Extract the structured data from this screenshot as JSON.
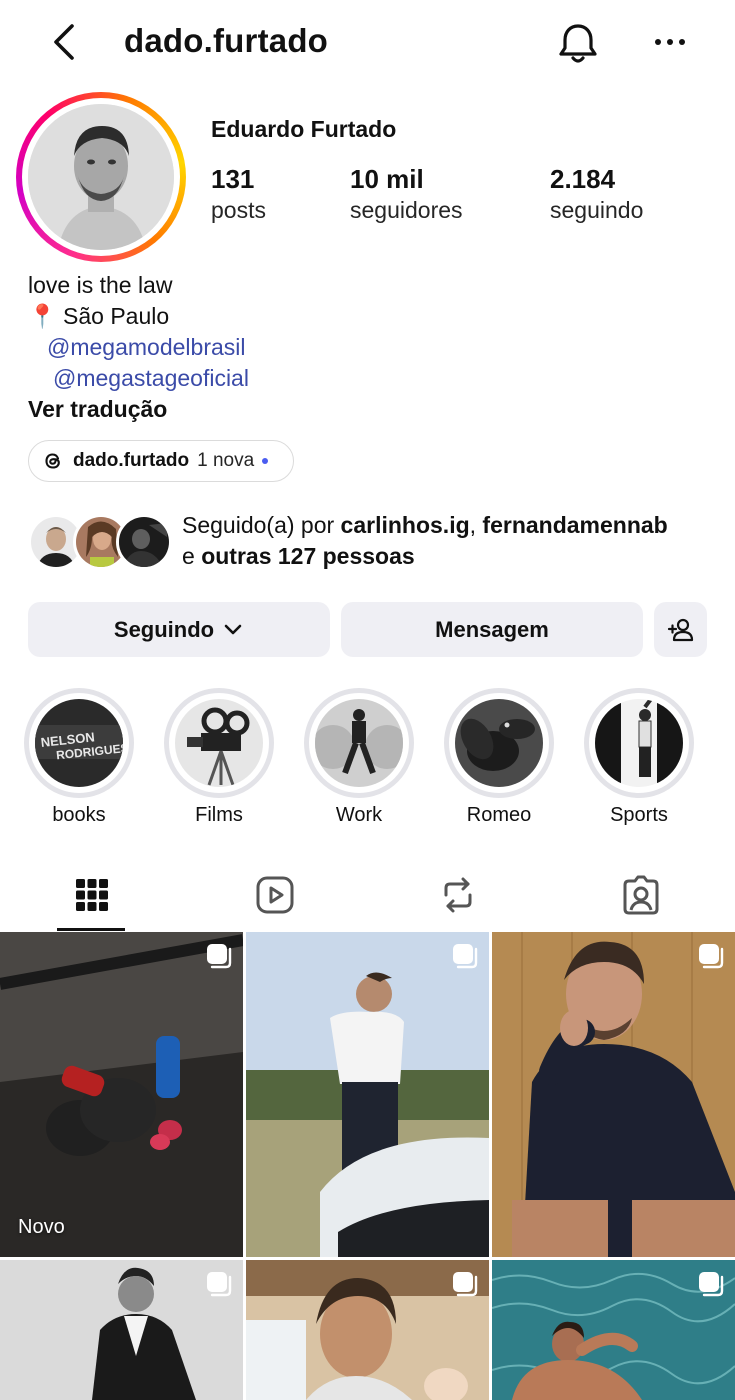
{
  "header": {
    "username": "dado.furtado",
    "icons": {
      "back": "chevron-left-icon",
      "notifications": "bell-icon",
      "more": "ellipsis-icon"
    }
  },
  "profile": {
    "full_name": "Eduardo Furtado",
    "stats": [
      {
        "value": "131",
        "label": "posts"
      },
      {
        "value": "10 mil",
        "label": "seguidores"
      },
      {
        "value": "2.184",
        "label": "seguindo"
      }
    ]
  },
  "bio": {
    "line1": "love is the law",
    "location_pin": "📍",
    "location": "São Paulo",
    "mention1": "@megamodelbrasil",
    "mention2": "@megastageoficial",
    "translate": "Ver tradução"
  },
  "threads": {
    "name": "dado.furtado",
    "badge": "1 nova"
  },
  "followed_by": {
    "prefix": "Seguido(a) por ",
    "user1": "carlinhos.ig",
    "separator": ", ",
    "user2": "fernandamennab",
    "and": "e ",
    "others": "outras 127 pessoas"
  },
  "actions": {
    "following": "Seguindo",
    "message": "Mensagem"
  },
  "highlights": [
    {
      "label": "books"
    },
    {
      "label": "Films"
    },
    {
      "label": "Work"
    },
    {
      "label": "Romeo"
    },
    {
      "label": "Sports"
    }
  ],
  "tabs": [
    {
      "name": "grid",
      "icon": "grid-icon",
      "active": true
    },
    {
      "name": "reels",
      "icon": "reels-icon",
      "active": false
    },
    {
      "name": "reposts",
      "icon": "repost-icon",
      "active": false
    },
    {
      "name": "tagged",
      "icon": "tagged-icon",
      "active": false
    }
  ],
  "posts": [
    {
      "badge": "Novo",
      "multi": true
    },
    {
      "badge": "",
      "multi": true
    },
    {
      "badge": "",
      "multi": true
    },
    {
      "badge": "",
      "multi": true
    },
    {
      "badge": "",
      "multi": true
    },
    {
      "badge": "",
      "multi": true
    }
  ],
  "colors": {
    "link": "#3b4ba8",
    "button_bg": "#efeff4",
    "new_dot": "#4a5cf0"
  }
}
